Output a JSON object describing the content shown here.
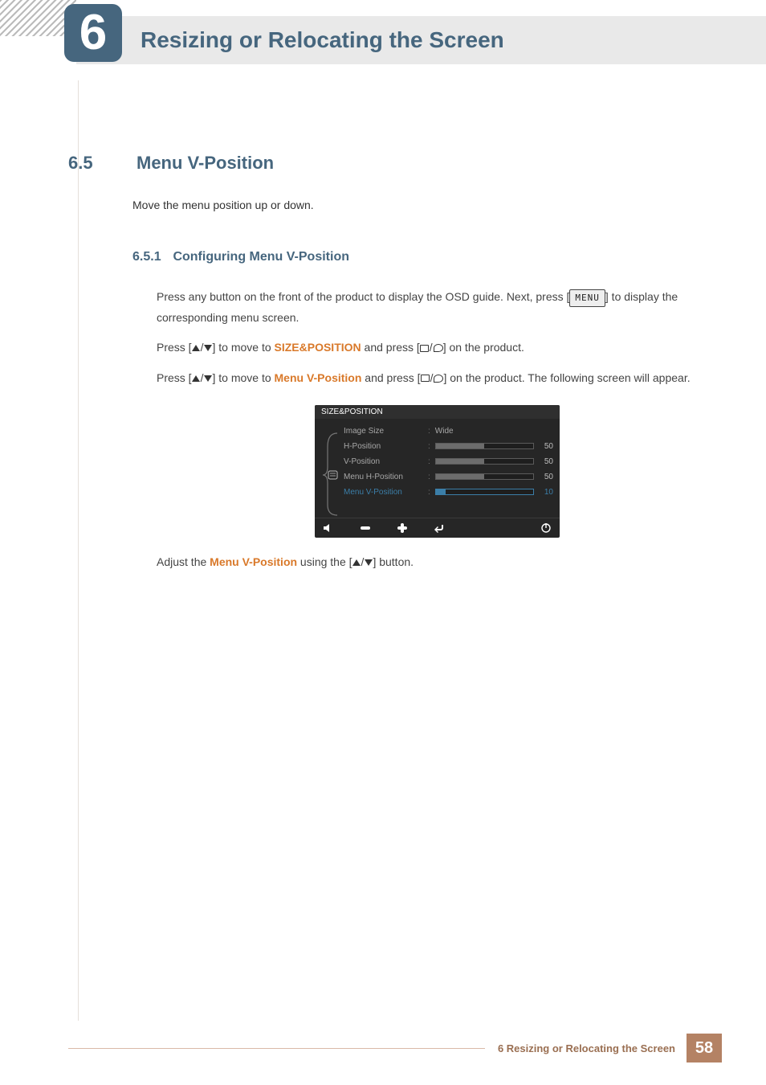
{
  "chapter": {
    "number": "6",
    "title": "Resizing or Relocating the Screen"
  },
  "section": {
    "number": "6.5",
    "title": "Menu V-Position",
    "description": "Move the menu position up or down."
  },
  "subsection": {
    "number": "6.5.1",
    "title": "Configuring Menu V-Position"
  },
  "steps": {
    "s1a": "Press any button on the front of the product to display the OSD guide. Next, press [",
    "s1b": "] to display the corresponding menu screen.",
    "s2a": "Press [",
    "s2b": "] to move to ",
    "s2_highlight": "SIZE&POSITION",
    "s2c": " and press [",
    "s2d": "] on the product.",
    "s3a": "Press [",
    "s3b": "] to move to ",
    "s3_highlight": "Menu V-Position",
    "s3c": " and press [",
    "s3d": "] on the product. The following screen will appear.",
    "menu_button": "MENU"
  },
  "osd": {
    "title": "SIZE&POSITION",
    "items": [
      {
        "label": "Image Size",
        "value_text": "Wide"
      },
      {
        "label": "H-Position",
        "value": 50
      },
      {
        "label": "V-Position",
        "value": 50
      },
      {
        "label": "Menu H-Position",
        "value": 50
      },
      {
        "label": "Menu V-Position",
        "value": 10,
        "active": true
      }
    ]
  },
  "closing": {
    "a": "Adjust the ",
    "highlight": "Menu V-Position",
    "b": " using the [",
    "c": "] button."
  },
  "footer": {
    "label": "6 Resizing or Relocating the Screen",
    "page": "58"
  }
}
